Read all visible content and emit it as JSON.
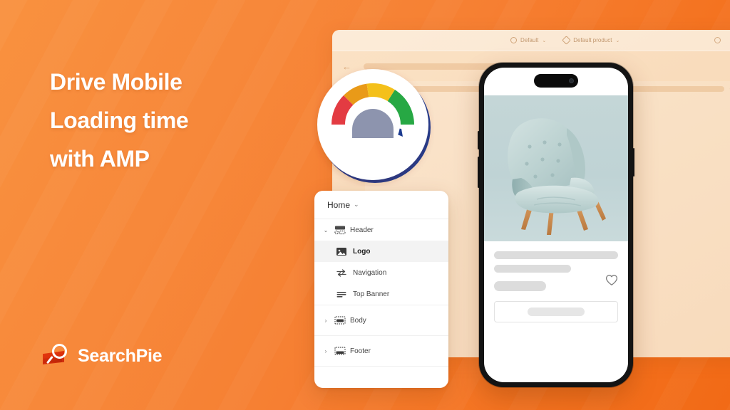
{
  "background": {
    "gradient_from": "#F9913F",
    "gradient_to": "#F26A16"
  },
  "headline": {
    "line1": "Drive Mobile",
    "line2": "Loading time",
    "line3": "with AMP",
    "color": "#FFFFFF"
  },
  "brand": {
    "name": "SearchPie",
    "mark_icon": "search-pie-logo-icon",
    "mark_color": "#E8390E"
  },
  "app_window": {
    "back_icon": "back-arrow-icon",
    "toolbar": {
      "items": [
        {
          "icon": "store-icon",
          "label": "Default",
          "caret": "⌄"
        },
        {
          "icon": "tag-icon",
          "label": "Default product",
          "caret": "⌄"
        }
      ],
      "right_icons": [
        "help-icon",
        "preview-icon"
      ]
    },
    "sidebar_icons": [
      "layout-icon",
      "apps-star-icon"
    ],
    "content_placeholder": {
      "chevron": "‹",
      "menu_dots": "•••"
    }
  },
  "gauge": {
    "name": "page-speed-gauge",
    "segments": [
      {
        "label": "red",
        "color": "#E33B42"
      },
      {
        "label": "orange",
        "color": "#E99A18"
      },
      {
        "label": "yellow",
        "color": "#F4C01A"
      },
      {
        "label": "green",
        "color": "#27A844"
      }
    ],
    "ring_color": "#1F3A93",
    "needle_color": "#1B3municipal",
    "center_color": "#8D94AE",
    "face_color": "#FFFFFF"
  },
  "panel": {
    "header": {
      "label": "Home",
      "caret": "⌄"
    },
    "groups": [
      {
        "name": "header",
        "row": {
          "label": "Header",
          "icon": "header-layout-icon",
          "chevron": "⌄",
          "expanded": true
        },
        "children": [
          {
            "label": "Logo",
            "icon": "image-icon",
            "selected": true
          },
          {
            "label": "Navigation",
            "icon": "swap-arrows-icon",
            "selected": false
          },
          {
            "label": "Top Banner",
            "icon": "lines-icon",
            "selected": false
          }
        ]
      },
      {
        "name": "body",
        "row": {
          "label": "Body",
          "icon": "body-layout-icon",
          "chevron": "›",
          "expanded": false
        },
        "children": []
      },
      {
        "name": "footer",
        "row": {
          "label": "Footer",
          "icon": "footer-layout-icon",
          "chevron": "›",
          "expanded": false
        },
        "children": []
      }
    ]
  },
  "phone": {
    "device": "smartphone-mockup",
    "product_image_alt": "mint-green-tufted-armchair",
    "product_image_bg": "#C4D6D7",
    "wishlist_icon": "heart-icon",
    "skeleton_lines": 3,
    "cta_button": "add-to-cart-button"
  }
}
